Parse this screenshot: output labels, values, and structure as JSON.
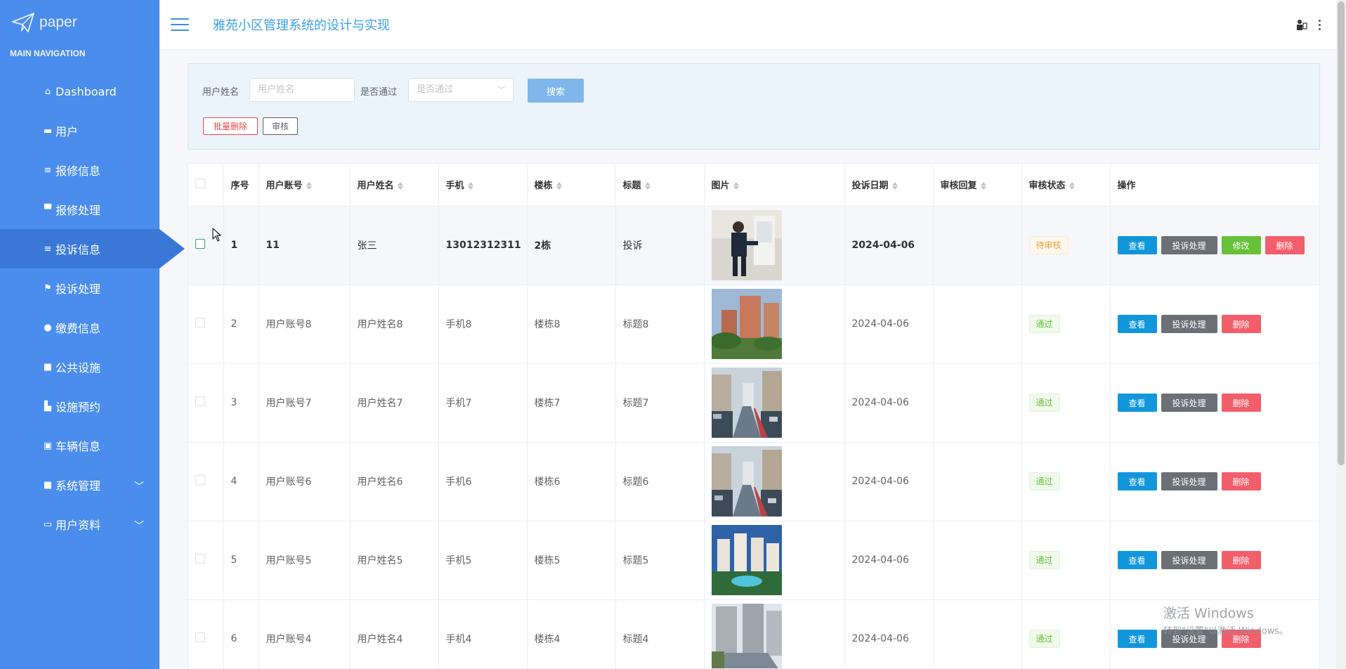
{
  "sidebar": {
    "logo_text": "paper",
    "heading": "MAIN NAVIGATION",
    "items": [
      {
        "label": "Dashboard",
        "icon": "home-icon"
      },
      {
        "label": "用户",
        "icon": "ticket-icon"
      },
      {
        "label": "报修信息",
        "icon": "list-icon"
      },
      {
        "label": "报修处理",
        "icon": "monitor-icon"
      },
      {
        "label": "投诉信息",
        "icon": "list-icon"
      },
      {
        "label": "投诉处理",
        "icon": "flag-icon"
      },
      {
        "label": "缴费信息",
        "icon": "user-icon"
      },
      {
        "label": "公共设施",
        "icon": "grid-icon"
      },
      {
        "label": "设施预约",
        "icon": "chart-icon"
      },
      {
        "label": "车辆信息",
        "icon": "clipboard-icon"
      },
      {
        "label": "系统管理",
        "icon": "grid-icon"
      },
      {
        "label": "用户资料",
        "icon": "card-icon"
      }
    ]
  },
  "header": {
    "title": "雅苑小区管理系统的设计与实现"
  },
  "search": {
    "name_label": "用户姓名",
    "name_placeholder": "用户姓名",
    "pass_label": "是否通过",
    "pass_placeholder": "是否通过",
    "search_button": "搜索",
    "batch_delete_button": "批量删除",
    "audit_button": "审核"
  },
  "table": {
    "columns": [
      "序号",
      "用户账号",
      "用户姓名",
      "手机",
      "楼栋",
      "标题",
      "图片",
      "投诉日期",
      "审核回复",
      "审核状态",
      "操作"
    ],
    "actions": {
      "view": "查看",
      "handle": "投诉处理",
      "edit": "修改",
      "delete": "删除"
    },
    "rows": [
      {
        "index": "1",
        "account": "11",
        "name": "张三",
        "phone": "13012312311",
        "building": "2栋",
        "title": "投诉",
        "date": "2024-04-06",
        "reply": "",
        "status": "待审核"
      },
      {
        "index": "2",
        "account": "用户账号8",
        "name": "用户姓名8",
        "phone": "手机8",
        "building": "楼栋8",
        "title": "标题8",
        "date": "2024-04-06",
        "reply": "",
        "status": "通过"
      },
      {
        "index": "3",
        "account": "用户账号7",
        "name": "用户姓名7",
        "phone": "手机7",
        "building": "楼栋7",
        "title": "标题7",
        "date": "2024-04-06",
        "reply": "",
        "status": "通过"
      },
      {
        "index": "4",
        "account": "用户账号6",
        "name": "用户姓名6",
        "phone": "手机6",
        "building": "楼栋6",
        "title": "标题6",
        "date": "2024-04-06",
        "reply": "",
        "status": "通过"
      },
      {
        "index": "5",
        "account": "用户账号5",
        "name": "用户姓名5",
        "phone": "手机5",
        "building": "楼栋5",
        "title": "标题5",
        "date": "2024-04-06",
        "reply": "",
        "status": "通过"
      },
      {
        "index": "6",
        "account": "用户账号4",
        "name": "用户姓名4",
        "phone": "手机4",
        "building": "楼栋4",
        "title": "标题4",
        "date": "2024-04-06",
        "reply": "",
        "status": "通过"
      }
    ]
  },
  "watermark": {
    "line1": "激活 Windows",
    "line2": "转到\"设置\"以激活 Windows。"
  },
  "colors": {
    "sidebar": "#4a8ded",
    "active": "#3a78d8",
    "title": "#3ba1e0",
    "view": "#1296db",
    "handle": "#6b7077",
    "edit": "#67c23a",
    "delete": "#f25e6a"
  }
}
